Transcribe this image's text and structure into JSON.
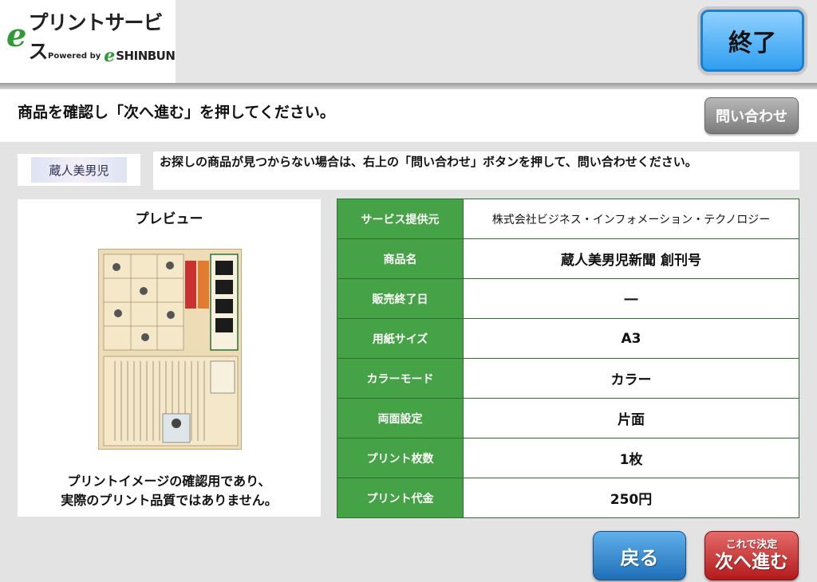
{
  "header": {
    "logo_e": "e",
    "logo_text": "プリントサービス",
    "logo_powered_by": "Powered by",
    "logo_sub_e": "e",
    "logo_sub_brand": "SHINBUN",
    "exit_label": "終了"
  },
  "instruction": {
    "text": "商品を確認し「次へ進む」を押してください。",
    "inquiry_label": "問い合わせ"
  },
  "brand": {
    "logo_text": "蔵人美男児"
  },
  "notice": {
    "text": "お探しの商品が見つからない場合は、右上の「問い合わせ」ボタンを押して、問い合わせください。"
  },
  "preview": {
    "title": "プレビュー",
    "caption_line1": "プリントイメージの確認用であり、",
    "caption_line2": "実際のプリント品質ではありません。"
  },
  "product_table": {
    "rows": [
      {
        "label": "サービス提供元",
        "value": "株式会社ビジネス・インフォメーション・テクノロジー"
      },
      {
        "label": "商品名",
        "value": "蔵人美男児新聞 創刊号"
      },
      {
        "label": "販売終了日",
        "value": "―"
      },
      {
        "label": "用紙サイズ",
        "value": "A3"
      },
      {
        "label": "カラーモード",
        "value": "カラー"
      },
      {
        "label": "両面設定",
        "value": "片面"
      },
      {
        "label": "プリント枚数",
        "value": "1枚"
      },
      {
        "label": "プリント代金",
        "value": "250円"
      }
    ]
  },
  "footer": {
    "back_label": "戻る",
    "proceed_sub": "これで決定",
    "proceed_main": "次へ進む"
  },
  "colors": {
    "green": "#46a246",
    "exit_blue": "#2f9ff0",
    "back_blue": "#1f6fb8",
    "proceed_red": "#b31a1a"
  }
}
